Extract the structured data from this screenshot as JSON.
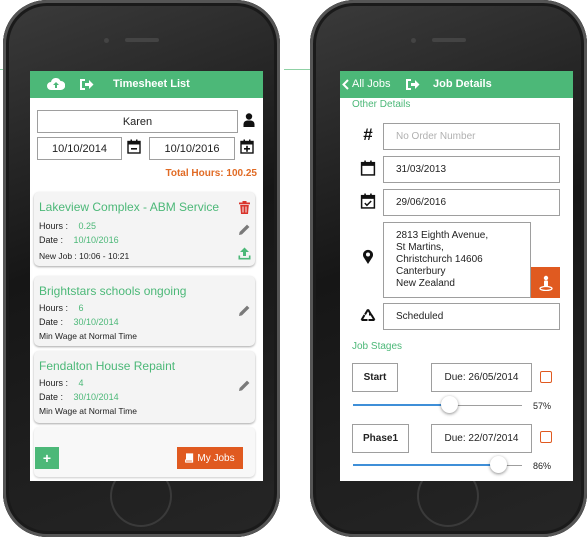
{
  "left_screen": {
    "topbar": {
      "title": "Timesheet List",
      "icons": [
        "cloud-upload-icon",
        "sign-out-icon"
      ]
    },
    "employee_name": "Karen",
    "date_from": "10/10/2014",
    "date_to": "10/10/2016",
    "total_hours": "Total Hours: 100.25",
    "jobs": [
      {
        "title": "Lakeview Complex - ABM Service",
        "hours_label": "Hours  :",
        "hours": "0.25",
        "date_label": "Date    :",
        "date": "10/10/2016",
        "note": "New Job : 10:06 - 10:21"
      },
      {
        "title": "Brightstars schools ongoing",
        "hours_label": "Hours  :",
        "hours": "6",
        "date_label": "Date    :",
        "date": "30/10/2014",
        "note": "Min Wage at Normal Time"
      },
      {
        "title": "Fendalton House Repaint",
        "hours_label": "Hours  :",
        "hours": "4",
        "date_label": "Date    :",
        "date": "30/10/2014",
        "note": "Min Wage at Normal Time"
      }
    ],
    "add_button": "+",
    "my_jobs_button": "My Jobs"
  },
  "right_screen": {
    "topbar": {
      "back_label": "All Jobs",
      "title": "Job Details"
    },
    "other_details_label": "Other Details",
    "order_number_placeholder": "No Order Number",
    "start_date": "31/03/2013",
    "end_date": "29/06/2016",
    "address_lines": [
      "2813 Eighth Avenue,",
      "St Martins,",
      "Christchurch 14606",
      "Canterbury",
      "New Zealand"
    ],
    "status": "Scheduled",
    "job_stages_label": "Job Stages",
    "stages": [
      {
        "name": "Start",
        "due": "Due: 26/05/2014",
        "progress": "57%",
        "progress_value": 0.57
      },
      {
        "name": "Phase1",
        "due": "Due: 22/07/2014",
        "progress": "86%",
        "progress_value": 0.86
      }
    ]
  },
  "colors": {
    "accent_green": "#4cb878",
    "accent_orange": "#e05a20",
    "total_orange": "#e16b25",
    "slider_blue": "#3f8fd8"
  }
}
